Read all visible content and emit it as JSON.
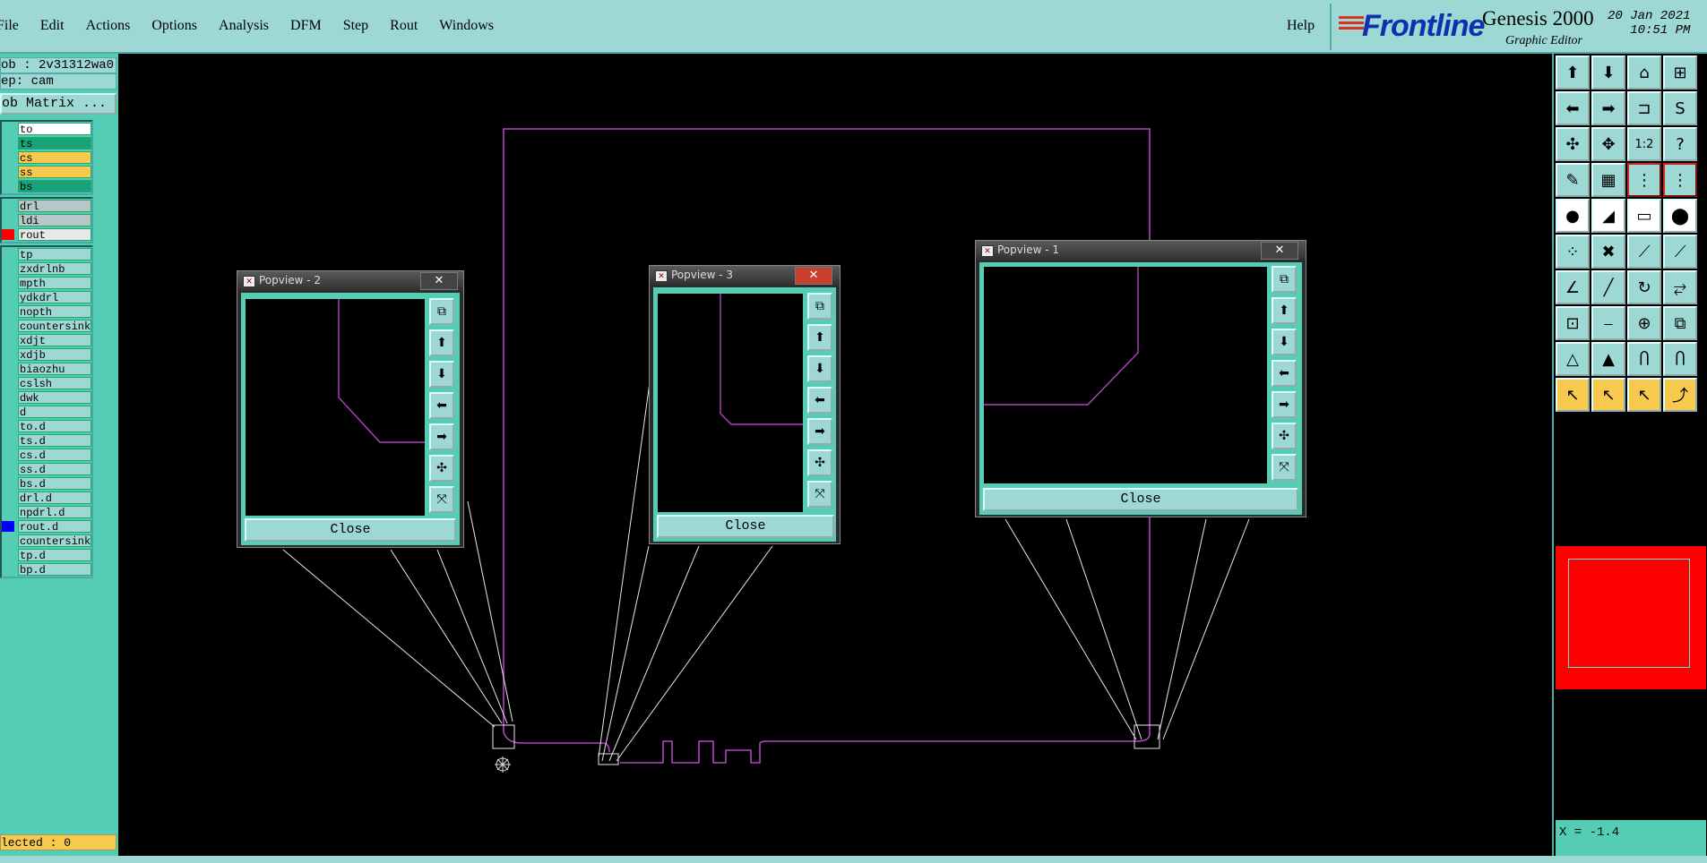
{
  "menu": {
    "items": [
      "File",
      "Edit",
      "Actions",
      "Options",
      "Analysis",
      "DFM",
      "Step",
      "Rout",
      "Windows"
    ],
    "help": "Help"
  },
  "brand": {
    "logo": "Frontline",
    "product": "Genesis 2000",
    "subtitle": "Graphic Editor",
    "date": "20 Jan 2021",
    "time": "10:51 PM"
  },
  "left_panel": {
    "job": "ob : 2v31312wa0",
    "step": "ep: cam",
    "matrix_button": "ob Matrix ...",
    "layers_board": [
      {
        "name": "to",
        "color": "#ffffff",
        "swatch": ""
      },
      {
        "name": "ts",
        "color": "#1aa27a",
        "swatch": ""
      },
      {
        "name": "cs",
        "color": "#f7c94e",
        "swatch": ""
      },
      {
        "name": "ss",
        "color": "#f7c94e",
        "swatch": ""
      },
      {
        "name": "bs",
        "color": "#1aa27a",
        "swatch": ""
      }
    ],
    "layers_drill": [
      {
        "name": "drl",
        "color": "#b9c6c8",
        "swatch": ""
      },
      {
        "name": "ldi",
        "color": "#b9c6c8",
        "swatch": ""
      },
      {
        "name": "rout",
        "color": "#e8e8e8",
        "swatch": "#ff0000"
      }
    ],
    "layers_misc": [
      {
        "name": "tp",
        "swatch": ""
      },
      {
        "name": "zxdrlnb",
        "swatch": ""
      },
      {
        "name": "mpth",
        "swatch": ""
      },
      {
        "name": "ydkdrl",
        "swatch": ""
      },
      {
        "name": "nopth",
        "swatch": ""
      },
      {
        "name": "countersink",
        "swatch": ""
      },
      {
        "name": "xdjt",
        "swatch": ""
      },
      {
        "name": "xdjb",
        "swatch": ""
      },
      {
        "name": "biaozhu",
        "swatch": ""
      },
      {
        "name": "cslsh",
        "swatch": ""
      },
      {
        "name": "dwk",
        "swatch": ""
      },
      {
        "name": "d",
        "swatch": ""
      },
      {
        "name": "to.d",
        "swatch": ""
      },
      {
        "name": "ts.d",
        "swatch": ""
      },
      {
        "name": "cs.d",
        "swatch": ""
      },
      {
        "name": "ss.d",
        "swatch": ""
      },
      {
        "name": "bs.d",
        "swatch": ""
      },
      {
        "name": "drl.d",
        "swatch": ""
      },
      {
        "name": "npdrl.d",
        "swatch": ""
      },
      {
        "name": "rout.d",
        "swatch": "#0000ff"
      },
      {
        "name": "countersink",
        "swatch": ""
      },
      {
        "name": "tp.d",
        "swatch": ""
      },
      {
        "name": "bp.d",
        "swatch": ""
      }
    ],
    "selected": "lected : 0"
  },
  "popviews": [
    {
      "title": "Popview - 2",
      "close_label": "Close",
      "x_glyph": "✕"
    },
    {
      "title": "Popview - 3",
      "close_label": "Close",
      "x_glyph": "✕"
    },
    {
      "title": "Popview - 1",
      "close_label": "Close",
      "x_glyph": "✕"
    }
  ],
  "popview_tools": [
    "zoom-window-icon",
    "pan-up-icon",
    "pan-down-icon",
    "pan-left-icon",
    "pan-right-icon",
    "zoom-home-icon",
    "zoom-fit-icon"
  ],
  "popview_tool_glyphs": [
    "⧉",
    "⬆",
    "⬇",
    "⬅",
    "➡",
    "✣",
    "⤧"
  ],
  "tools": [
    {
      "name": "pan-up-icon",
      "glyph": "⬆",
      "style": ""
    },
    {
      "name": "pan-down-icon",
      "glyph": "⬇",
      "style": ""
    },
    {
      "name": "home-icon",
      "glyph": "⌂",
      "style": ""
    },
    {
      "name": "zoom-box-icon",
      "glyph": "⊞",
      "style": ""
    },
    {
      "name": "pan-left-icon",
      "glyph": "⬅",
      "style": ""
    },
    {
      "name": "pan-right-icon",
      "glyph": "➡",
      "style": ""
    },
    {
      "name": "snap-icon",
      "glyph": "⊐",
      "style": ""
    },
    {
      "name": "route-icon",
      "glyph": "S",
      "style": ""
    },
    {
      "name": "zoom-in-icon",
      "glyph": "✣",
      "style": ""
    },
    {
      "name": "zoom-out-icon",
      "glyph": "✥",
      "style": ""
    },
    {
      "name": "scale-icon",
      "glyph": "1:2",
      "style": ""
    },
    {
      "name": "help-icon",
      "glyph": "?",
      "style": ""
    },
    {
      "name": "palette-icon",
      "glyph": "✎",
      "style": ""
    },
    {
      "name": "grid-icon",
      "glyph": "▦",
      "style": ""
    },
    {
      "name": "connect-icon",
      "glyph": "⋮",
      "style": "redborder"
    },
    {
      "name": "connect-alt-icon",
      "glyph": "⋮",
      "style": "redborder"
    },
    {
      "name": "pad-icon",
      "glyph": "●",
      "style": "white"
    },
    {
      "name": "measure-icon",
      "glyph": "◢",
      "style": "white"
    },
    {
      "name": "ruler-icon",
      "glyph": "▭",
      "style": "white"
    },
    {
      "name": "dot-icon",
      "glyph": "⬤",
      "style": "white"
    },
    {
      "name": "link-icon",
      "glyph": "⁘",
      "style": ""
    },
    {
      "name": "cross-icon",
      "glyph": "✖",
      "style": ""
    },
    {
      "name": "line-end-icon",
      "glyph": "⟋",
      "style": ""
    },
    {
      "name": "line-pad-icon",
      "glyph": "⟋",
      "style": ""
    },
    {
      "name": "angle-icon",
      "glyph": "∠",
      "style": ""
    },
    {
      "name": "slash-icon",
      "glyph": "╱",
      "style": ""
    },
    {
      "name": "rotate-icon",
      "glyph": "↻",
      "style": ""
    },
    {
      "name": "flip-icon",
      "glyph": "⥂",
      "style": ""
    },
    {
      "name": "copy-pad-icon",
      "glyph": "⊡",
      "style": ""
    },
    {
      "name": "line-split-icon",
      "glyph": "⎯",
      "style": ""
    },
    {
      "name": "center-icon",
      "glyph": "⊕",
      "style": ""
    },
    {
      "name": "group-icon",
      "glyph": "⧉",
      "style": ""
    },
    {
      "name": "triangle-icon",
      "glyph": "△",
      "style": ""
    },
    {
      "name": "triangle-alt-icon",
      "glyph": "▲",
      "style": ""
    },
    {
      "name": "arch-icon",
      "glyph": "Ⴖ",
      "style": ""
    },
    {
      "name": "arch-alt-icon",
      "glyph": "Ⴖ",
      "style": ""
    },
    {
      "name": "pointer-icon",
      "glyph": "↖",
      "style": "orange"
    },
    {
      "name": "pointer-alt-icon",
      "glyph": "↖",
      "style": "orange"
    },
    {
      "name": "select-icon",
      "glyph": "↖",
      "style": "orange"
    },
    {
      "name": "node-select-icon",
      "glyph": "⤴",
      "style": "orange"
    }
  ],
  "status": {
    "x_coord": "X = -1.4"
  }
}
